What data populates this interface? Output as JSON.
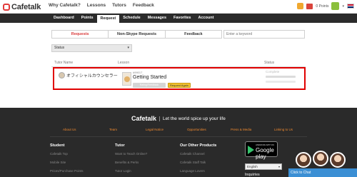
{
  "topbar": {
    "brand": "Cafetalk",
    "nav": [
      "Why Cafetalk?",
      "Lessons",
      "Tutors",
      "Feedback"
    ],
    "points": "0 Points",
    "caret": "▾"
  },
  "mainnav": {
    "items": [
      "Dashboard",
      "Points",
      "Request",
      "Schedule",
      "Messages",
      "Favorites",
      "Account"
    ],
    "active_index": 2
  },
  "tabs": [
    {
      "label": "Requests",
      "active": true
    },
    {
      "label": "Non-Skype Requests",
      "active": false
    },
    {
      "label": "Feedback",
      "active": false
    }
  ],
  "search": {
    "placeholder": "Enter a keyword"
  },
  "filter": {
    "value": "Status",
    "arrow": "▾"
  },
  "table": {
    "headers": {
      "tutor": "Tutor Name",
      "lesson": "Lesson",
      "status": "Status"
    },
    "row": {
      "tutor_name": "オフィシャルカウンセラー",
      "lesson_id": "#99017",
      "lesson_title": "Getting Started",
      "gray_button": "Rating/Feedback",
      "request_again": "Request Again",
      "status": "Complete"
    }
  },
  "footer": {
    "brand": "Cafetalk",
    "tagline": "Let the world spice up your life",
    "links": [
      "About Us",
      "Team",
      "Legal Notice",
      "Opportunities",
      "Press & Media",
      "Linking to Us"
    ],
    "columns": [
      {
        "heading": "Student",
        "items": [
          "Cafetalk Top",
          "Mobile Site",
          "Prices/Purchase Points"
        ]
      },
      {
        "heading": "Tutor",
        "items": [
          "Want to Teach Online?",
          "Benefits & Perks",
          "Tutor Login"
        ]
      },
      {
        "heading": "Our Other Products",
        "items": [
          "Cafetalk Channel",
          "Cafetalk Staff Talk",
          "Language Lovers"
        ]
      }
    ],
    "gplay_small": "ANDROID APP ON",
    "gplay_big": "Google play",
    "language": "English",
    "language_arrow": "▾",
    "inquiries": "Inquiries",
    "chat": "Click to Chat"
  },
  "colors": {
    "accent_red": "#d93b3b",
    "highlight_border": "#e00000",
    "footer_link": "#f08a30",
    "request_again_button": "#f2c230",
    "dark_nav": "#2b2b2b",
    "chat_blue": "#3b8fd4"
  }
}
